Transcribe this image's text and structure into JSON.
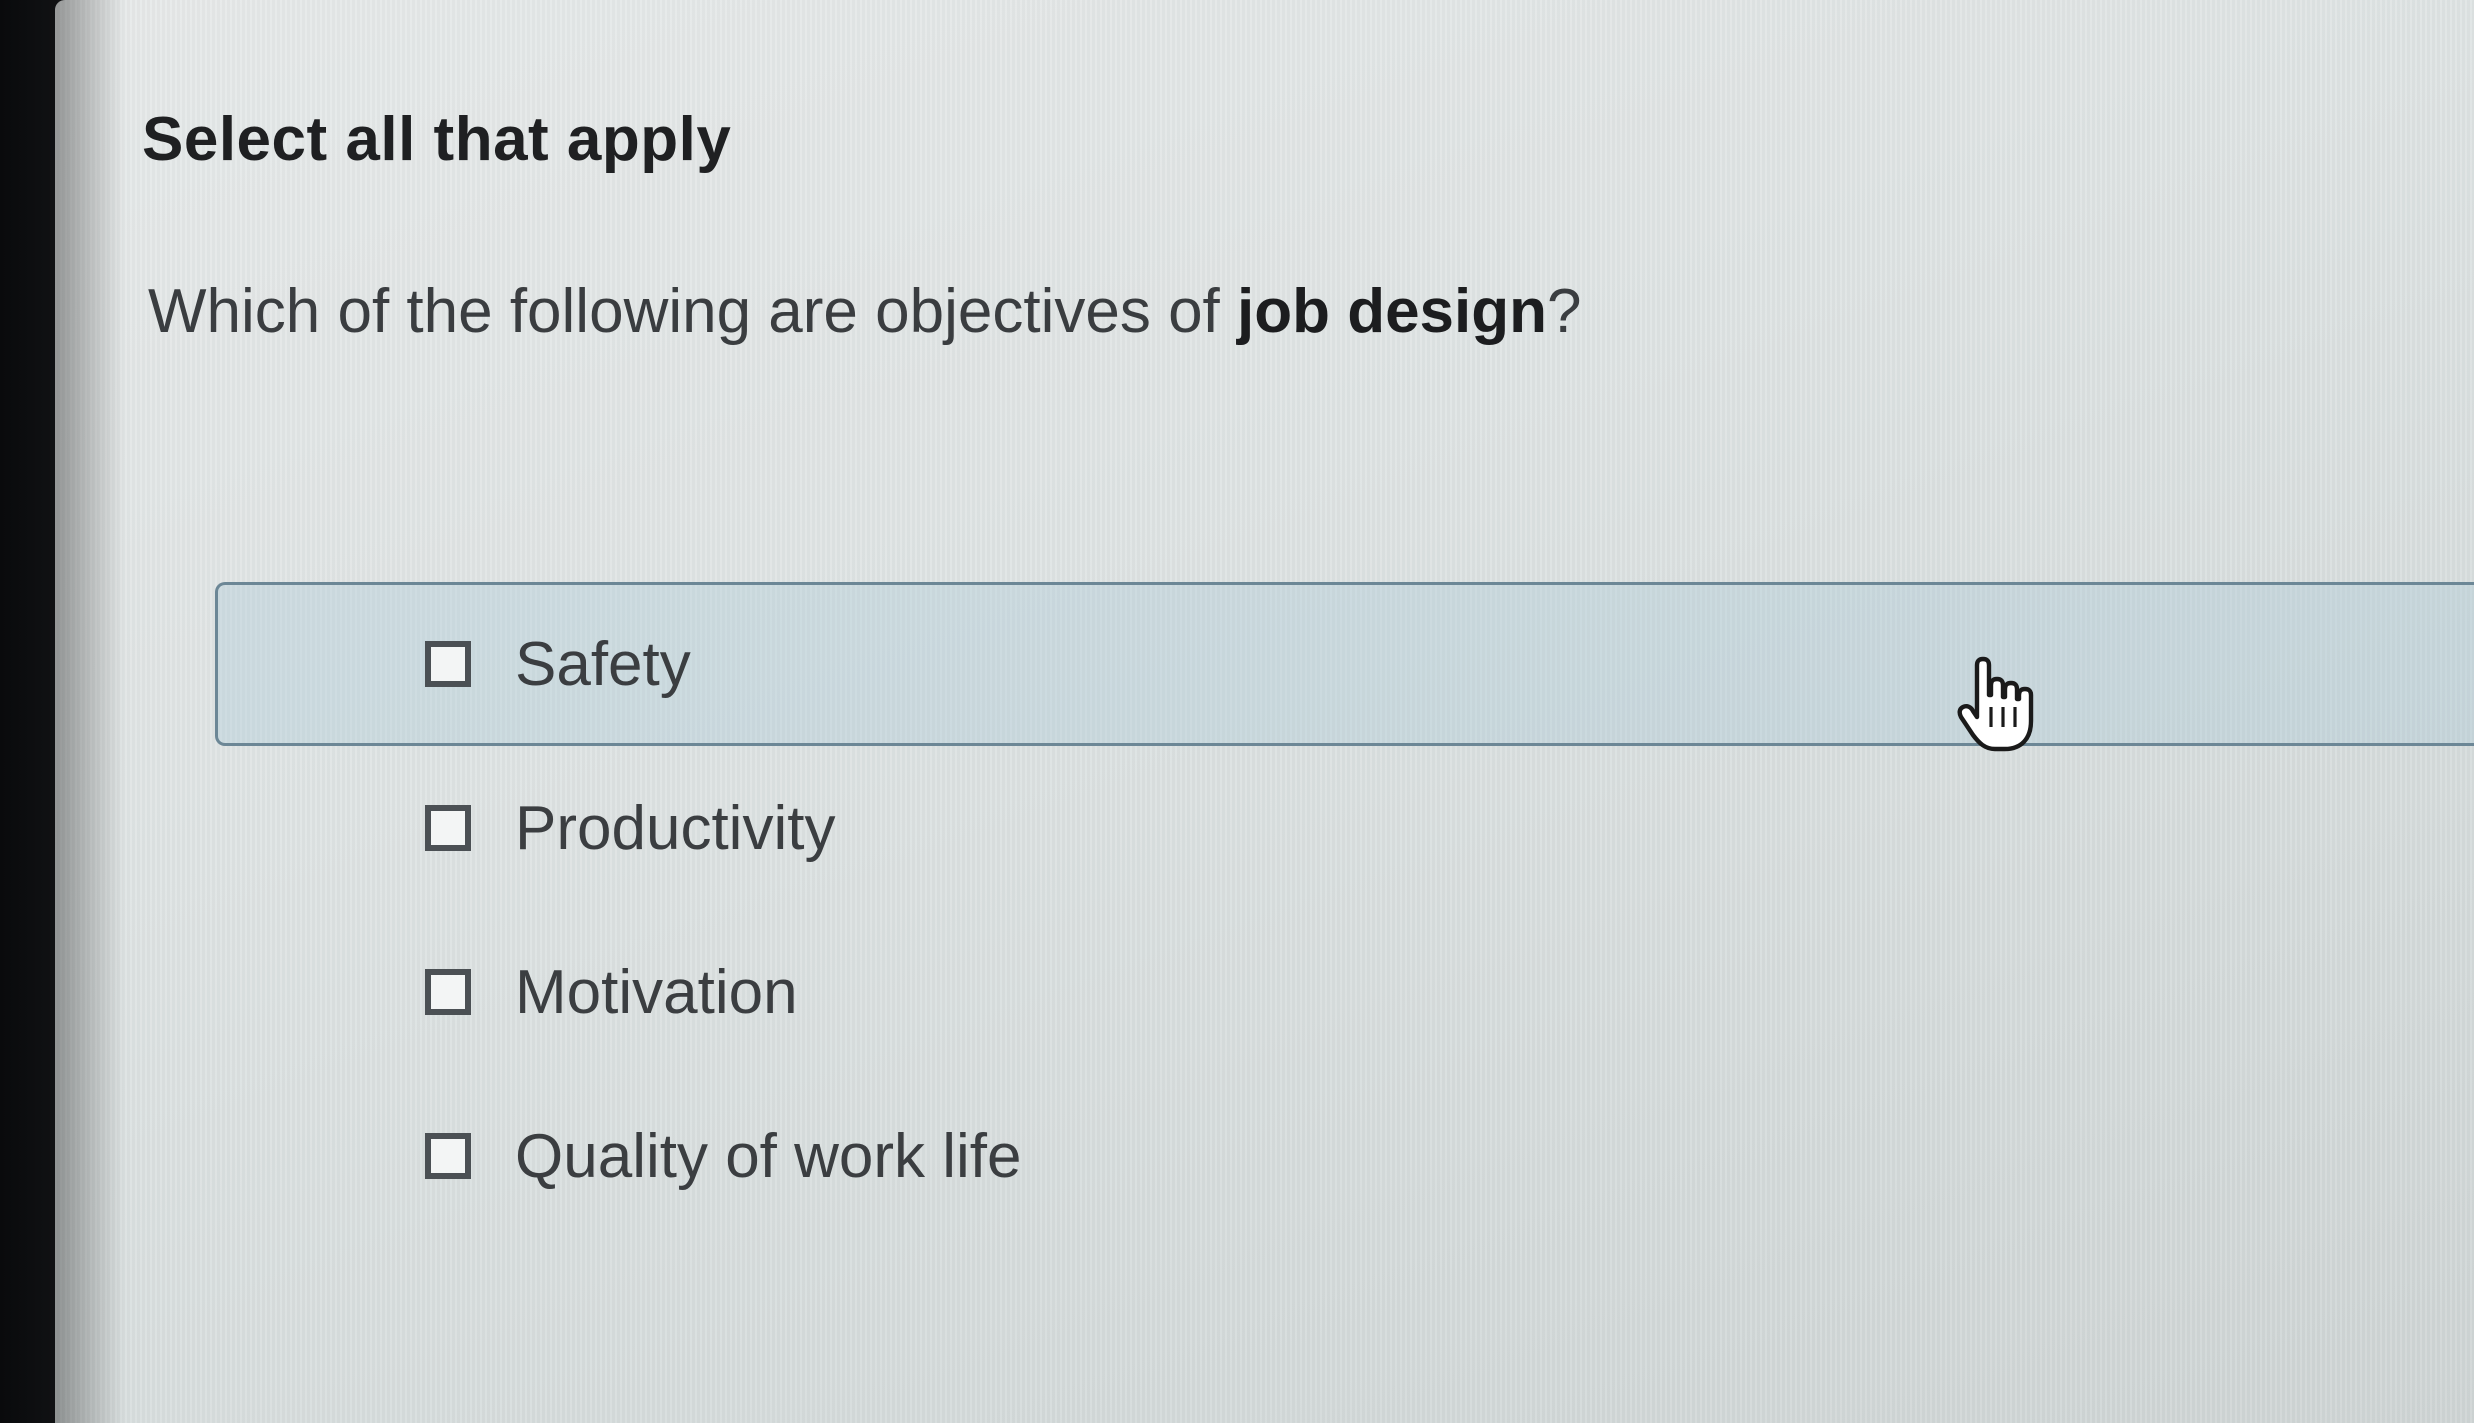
{
  "question": {
    "instructions": "Select all that apply",
    "prompt_prefix": "Which of the following are objectives of ",
    "prompt_bold": "job design",
    "prompt_suffix": "?"
  },
  "options": [
    {
      "label": "Safety",
      "checked": false,
      "hovered": true
    },
    {
      "label": "Productivity",
      "checked": false,
      "hovered": false
    },
    {
      "label": "Motivation",
      "checked": false,
      "hovered": false
    },
    {
      "label": "Quality of work life",
      "checked": false,
      "hovered": false
    }
  ],
  "cursor": {
    "icon": "hand-pointer-icon"
  }
}
